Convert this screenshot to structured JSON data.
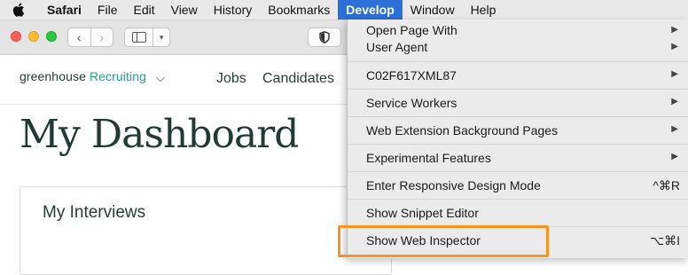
{
  "menubar": {
    "apple_icon": "apple-logo-icon",
    "items": [
      "Safari",
      "File",
      "Edit",
      "View",
      "History",
      "Bookmarks",
      "Develop",
      "Window",
      "Help"
    ],
    "active_item": "Develop"
  },
  "toolbar": {
    "back_icon": "‹",
    "forward_icon": "›",
    "sidebar_icon": "sidebar-icon",
    "sidebar_chevron": "▾",
    "shield_icon": "shield-icon"
  },
  "page": {
    "logo_prefix": "greenhouse",
    "logo_suffix": "Recruiting",
    "logo_chevron": "⌵",
    "nav": [
      "Jobs",
      "Candidates"
    ],
    "title": "My Dashboard",
    "card_title": "My Interviews"
  },
  "develop_menu": {
    "open_page_with_line1": "Open Page With",
    "open_page_with_line2": "User Agent",
    "device": "C02F617XML87",
    "service_workers": "Service Workers",
    "web_extension": "Web Extension Background Pages",
    "experimental": "Experimental Features",
    "responsive": "Enter Responsive Design Mode",
    "responsive_shortcut": "^⌘R",
    "snippet": "Show Snippet Editor",
    "inspector": "Show Web Inspector",
    "inspector_shortcut": "⌥⌘I",
    "submenu_arrow": "▶"
  },
  "colors": {
    "menu_highlight": "#2c6fd7",
    "callout_border": "#f7941d",
    "brand_green": "#24a47f",
    "heading": "#1f3b34"
  }
}
